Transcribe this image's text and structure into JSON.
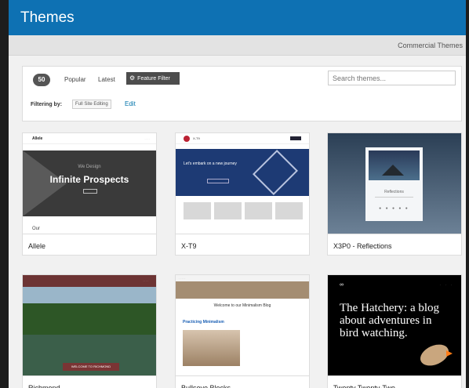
{
  "header": {
    "title": "Themes"
  },
  "subbar": {
    "link": "Commercial Themes"
  },
  "filter": {
    "count": "50",
    "tabs": [
      "Popular",
      "Latest"
    ],
    "feature_filter": "Feature Filter",
    "search_placeholder": "Search themes...",
    "filtering_label": "Filtering by:",
    "chip": "Full Site Editing",
    "edit": "Edit"
  },
  "themes": [
    {
      "name": "Allele",
      "small1": "We Design",
      "hero": "Infinite Prospects",
      "our": "Our"
    },
    {
      "name": "X-T9",
      "hero": "Let's embark on a new journey"
    },
    {
      "name": "X3P0 - Reflections",
      "hero": "Reflections"
    },
    {
      "name": "Richmond",
      "hero": "WELCOME TO RICHMOND"
    },
    {
      "name": "Bullseye Blocks",
      "hero": "Welcome to our Minimalism Blog",
      "post": "Practicing Minimalism"
    },
    {
      "name": "Twenty Twenty-Two",
      "hero": "The Hatchery: a blog about adventures in bird watching."
    }
  ],
  "colors": {
    "header_bg": "#0e71b3",
    "accent": "#0073aa",
    "dark_button": "#4d4d4d"
  },
  "icons": {
    "gear": "gear-icon"
  }
}
